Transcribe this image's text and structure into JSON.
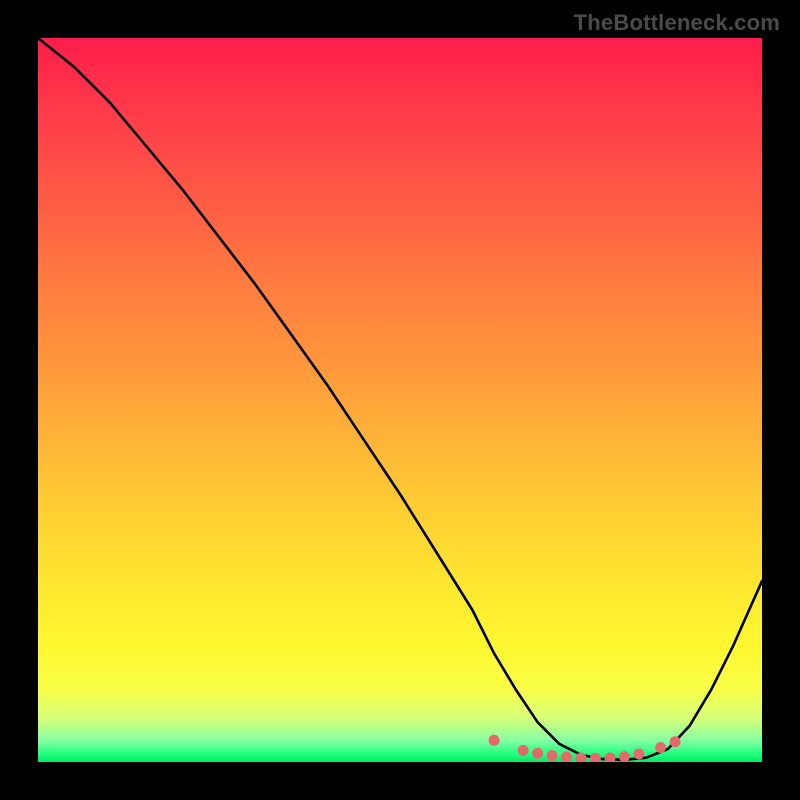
{
  "watermark": "TheBottleneck.com",
  "chart_data": {
    "type": "line",
    "title": "",
    "xlabel": "",
    "ylabel": "",
    "xlim": [
      0,
      100
    ],
    "ylim": [
      0,
      100
    ],
    "series": [
      {
        "name": "bottleneck-curve",
        "x": [
          0,
          5,
          10,
          15,
          20,
          25,
          30,
          35,
          40,
          45,
          50,
          55,
          60,
          63,
          66,
          69,
          72,
          75,
          78,
          81,
          84,
          87,
          90,
          93,
          96,
          100
        ],
        "y": [
          100,
          96,
          91,
          85,
          79,
          72.5,
          66,
          59,
          52,
          44.5,
          37,
          29,
          21,
          15,
          10,
          5.5,
          2.5,
          1.0,
          0.4,
          0.3,
          0.6,
          1.8,
          5.0,
          10,
          16,
          25
        ]
      }
    ],
    "markers": {
      "name": "optimal-zone-dots",
      "x": [
        63,
        67,
        69,
        71,
        73,
        75,
        77,
        79,
        81,
        83,
        86,
        88
      ],
      "y": [
        3.0,
        1.6,
        1.2,
        0.9,
        0.7,
        0.55,
        0.5,
        0.55,
        0.75,
        1.1,
        2.0,
        2.8
      ]
    },
    "colors": {
      "curve": "#000000",
      "markers": "#e46a6a",
      "gradient_top": "#ff1d4a",
      "gradient_bottom": "#00e867"
    }
  }
}
